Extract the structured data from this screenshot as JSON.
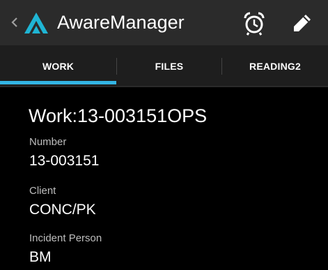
{
  "actionbar": {
    "title": "AwareManager",
    "logo_icon": "aware-logo-icon",
    "actions": [
      {
        "icon": "alarm-clock-icon"
      },
      {
        "icon": "pencil-edit-icon"
      }
    ],
    "colors": {
      "background": "#2b2b2b",
      "logo": "#1fb5d4"
    }
  },
  "tabs": {
    "items": [
      {
        "label": "WORK",
        "selected": true
      },
      {
        "label": "FILES",
        "selected": false
      },
      {
        "label": "READING2",
        "selected": false
      }
    ],
    "indicator_color": "#33b5e5"
  },
  "work": {
    "title": "Work:13-003151OPS",
    "fields": [
      {
        "label": "Number",
        "value": "13-003151"
      },
      {
        "label": "Client",
        "value": "CONC/PK"
      },
      {
        "label": "Incident Person",
        "value": "BM"
      }
    ]
  }
}
